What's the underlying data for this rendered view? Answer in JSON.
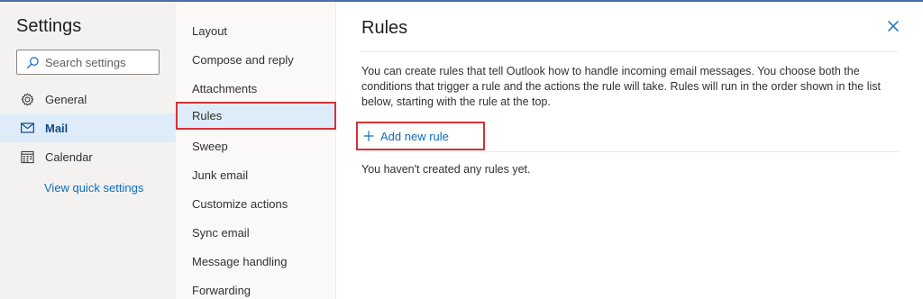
{
  "settings": {
    "title": "Settings",
    "search_placeholder": "Search settings",
    "nav": [
      {
        "label": "General",
        "icon": "gear-icon"
      },
      {
        "label": "Mail",
        "icon": "mail-icon",
        "active": true
      },
      {
        "label": "Calendar",
        "icon": "calendar-icon"
      }
    ],
    "quick_settings_link": "View quick settings"
  },
  "mail_menu": {
    "items": [
      "Layout",
      "Compose and reply",
      "Attachments",
      "Rules",
      "Sweep",
      "Junk email",
      "Customize actions",
      "Sync email",
      "Message handling",
      "Forwarding"
    ],
    "active": "Rules"
  },
  "rules_pane": {
    "title": "Rules",
    "description": "You can create rules that tell Outlook how to handle incoming email messages. You choose both the conditions that trigger a rule and the actions the rule will take. Rules will run in the order shown in the list below, starting with the rule at the top.",
    "add_rule_label": "Add new rule",
    "empty_text": "You haven't created any rules yet."
  },
  "colors": {
    "accent": "#0f6cbd",
    "highlight_outline": "#d13438",
    "selected_bg": "#deecf9",
    "left_nav_bg": "#f3f2f1"
  }
}
